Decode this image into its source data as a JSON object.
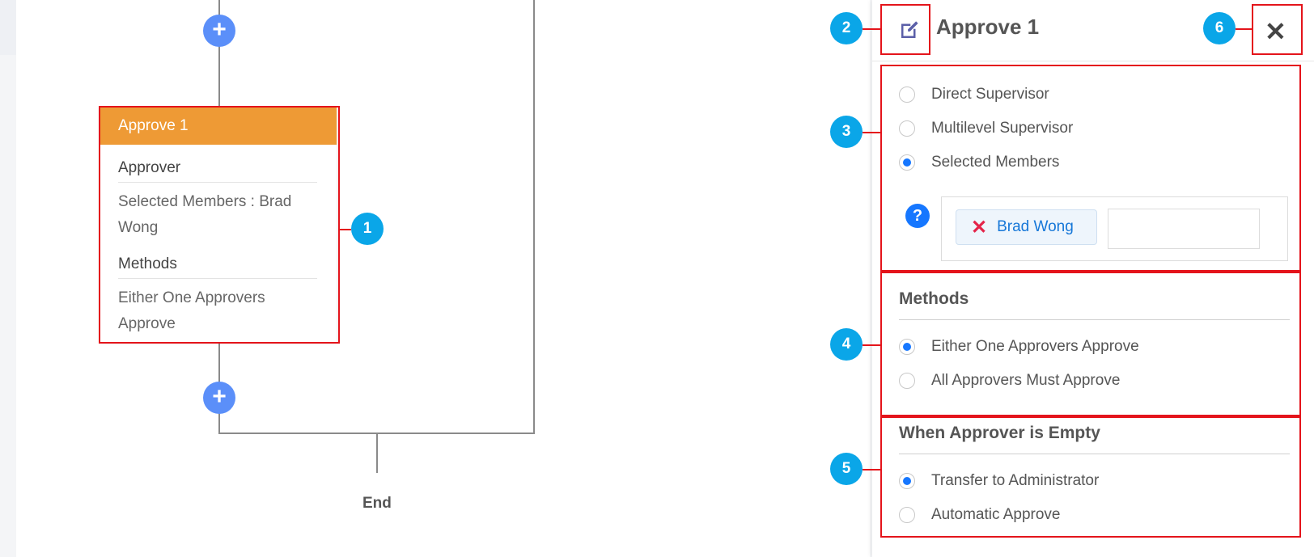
{
  "flow": {
    "node": {
      "header": "Approve 1",
      "approver_title": "Approver",
      "approver_text": "Selected Members : Brad Wong",
      "methods_title": "Methods",
      "methods_text": "Either One Approvers Approve"
    },
    "end_label": "End",
    "add_button_glyph": "+"
  },
  "panel": {
    "title": "Approve 1",
    "close_glyph": "✕",
    "approver_options": [
      {
        "label": "Direct Supervisor",
        "checked": false
      },
      {
        "label": "Multilevel Supervisor",
        "checked": false
      },
      {
        "label": "Selected Members",
        "checked": true
      }
    ],
    "selected_member": "Brad Wong",
    "help_glyph": "?",
    "chip_remove_glyph": "✕",
    "methods": {
      "title": "Methods",
      "options": [
        {
          "label": "Either One Approvers Approve",
          "checked": true
        },
        {
          "label": "All Approvers Must Approve",
          "checked": false
        }
      ]
    },
    "empty": {
      "title": "When Approver is Empty",
      "options": [
        {
          "label": "Transfer to Administrator",
          "checked": true
        },
        {
          "label": "Automatic Approve",
          "checked": false
        }
      ]
    }
  },
  "annotations": [
    "1",
    "2",
    "3",
    "4",
    "5",
    "6"
  ],
  "colors": {
    "node_header": "#ee9a35",
    "add_button": "#5b8ff9",
    "annotation_border": "#e4141b",
    "badge": "#0aa6e8",
    "radio_checked": "#1677ff",
    "chip_text": "#1677d8"
  }
}
